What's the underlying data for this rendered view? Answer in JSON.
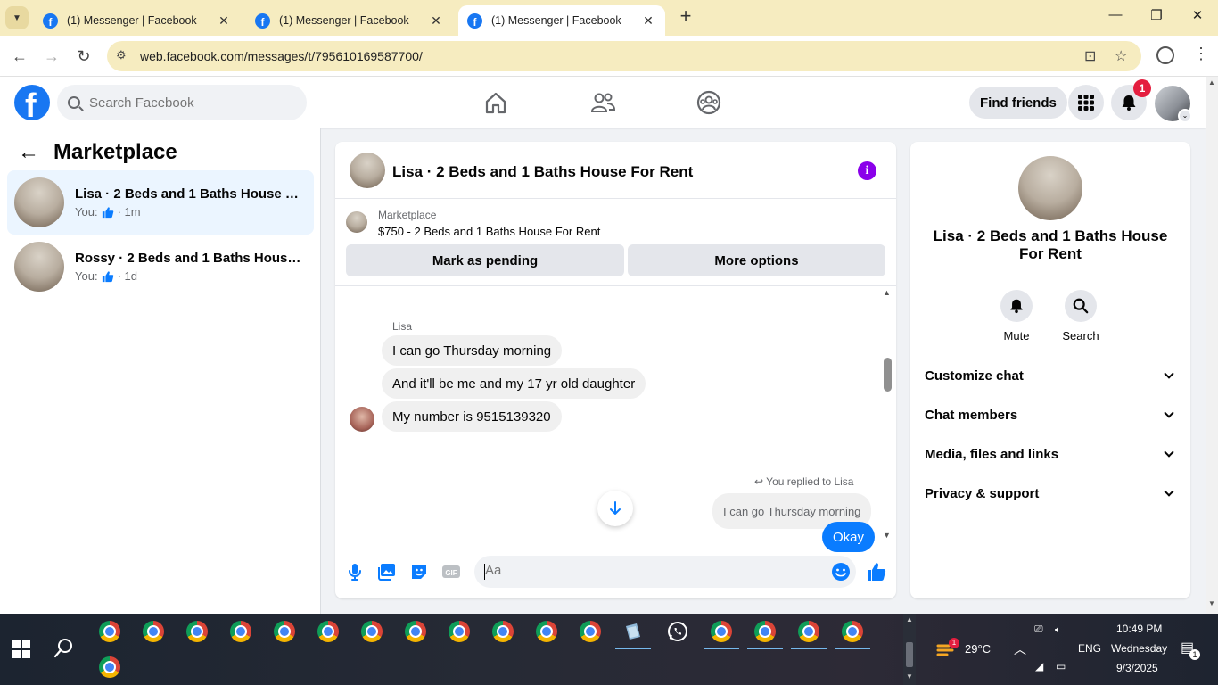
{
  "browser": {
    "tabs": [
      {
        "title": "(1) Messenger | Facebook"
      },
      {
        "title": "(1) Messenger | Facebook"
      },
      {
        "title": "(1) Messenger | Facebook"
      }
    ],
    "url": "web.facebook.com/messages/t/795610169587700/"
  },
  "header": {
    "search_placeholder": "Search Facebook",
    "find_friends": "Find friends",
    "notification_count": "1"
  },
  "sidebar": {
    "title": "Marketplace",
    "conversations": [
      {
        "name": "Lisa · 2 Beds and 1 Baths House Fo...",
        "prefix": "You:",
        "time": "· 1m"
      },
      {
        "name": "Rossy · 2 Beds and 1 Baths House F...",
        "prefix": "You:",
        "time": "· 1d"
      }
    ]
  },
  "chat": {
    "title": "Lisa · 2 Beds and 1 Baths House For Rent",
    "marketplace_label": "Marketplace",
    "listing": "$750 - 2 Beds and 1 Baths House For Rent",
    "mark_pending": "Mark as pending",
    "more_options": "More options",
    "sender": "Lisa",
    "messages": [
      "I can go Thursday  morning",
      "And it'll be me and my 17 yr old daughter",
      "My number is 9515139320"
    ],
    "reply_note": "You replied to Lisa",
    "quoted": "I can go Thursday  morning",
    "my_reply": "Okay",
    "composer_placeholder": "Aa"
  },
  "details": {
    "title": "Lisa · 2 Beds and 1 Baths House For Rent",
    "mute": "Mute",
    "search": "Search",
    "sections": [
      "Customize chat",
      "Chat members",
      "Media, files and links",
      "Privacy & support"
    ]
  },
  "taskbar": {
    "temperature": "29°C",
    "weather_badge": "1",
    "language": "ENG",
    "time": "10:49 PM",
    "day": "Wednesday",
    "date": "9/3/2025",
    "notification_count": "1"
  },
  "colors": {
    "facebook_blue": "#1877f2",
    "messenger_blue": "#0a7cff",
    "info_purple": "#8a00ea",
    "notification_red": "#e41e3f",
    "browser_frame": "#f6ecc0"
  }
}
